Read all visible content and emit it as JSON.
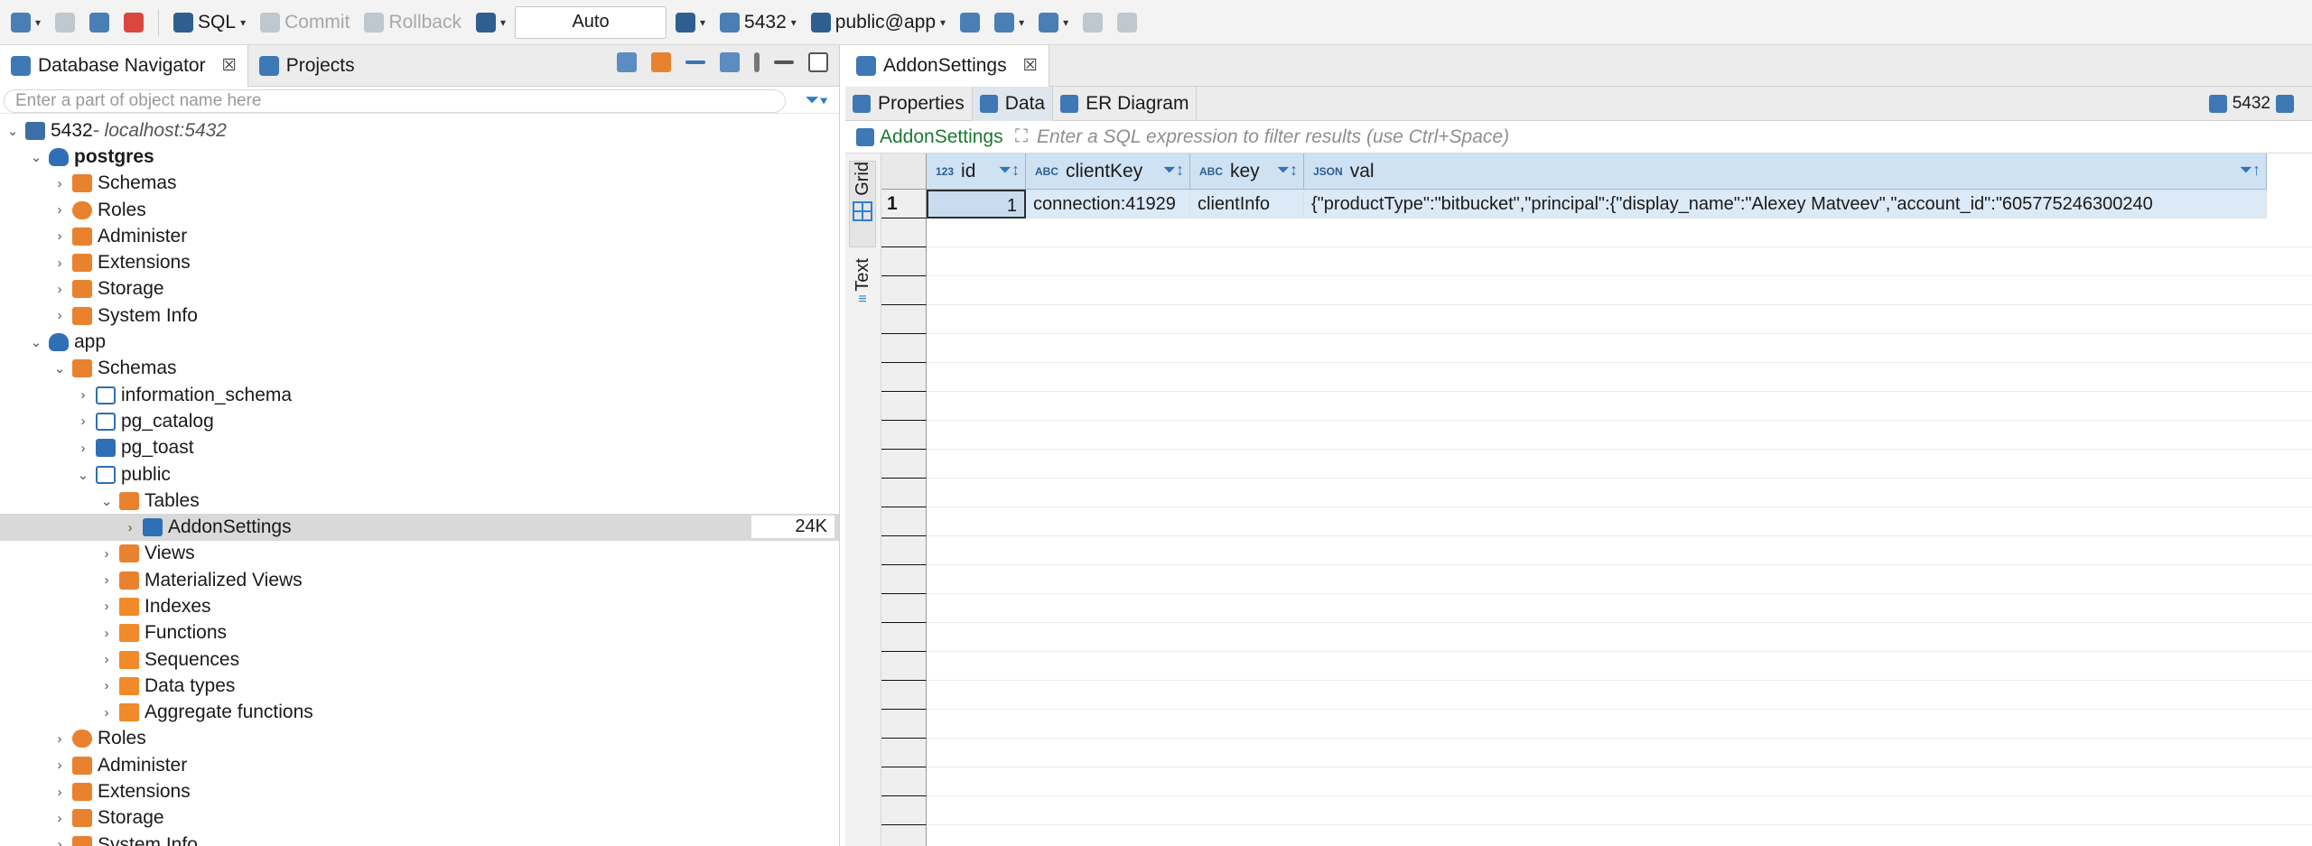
{
  "toolbar": {
    "sql_label": "SQL",
    "commit_label": "Commit",
    "rollback_label": "Rollback",
    "transaction_mode": "Auto",
    "connection": "5432",
    "schema": "public@app"
  },
  "navigator": {
    "tab_label": "Database Navigator",
    "projects_label": "Projects",
    "filter_placeholder": "Enter a part of object name here",
    "connection_name": "5432",
    "connection_host": " - localhost:5432",
    "nodes": [
      {
        "label": "postgres"
      },
      {
        "label": "Schemas"
      },
      {
        "label": "Roles"
      },
      {
        "label": "Administer"
      },
      {
        "label": "Extensions"
      },
      {
        "label": "Storage"
      },
      {
        "label": "System Info"
      },
      {
        "label": "app"
      },
      {
        "label": "Schemas"
      },
      {
        "label": "information_schema"
      },
      {
        "label": "pg_catalog"
      },
      {
        "label": "pg_toast"
      },
      {
        "label": "public"
      },
      {
        "label": "Tables"
      },
      {
        "label": "AddonSettings",
        "size": "24K"
      },
      {
        "label": "Views"
      },
      {
        "label": "Materialized Views"
      },
      {
        "label": "Indexes"
      },
      {
        "label": "Functions"
      },
      {
        "label": "Sequences"
      },
      {
        "label": "Data types"
      },
      {
        "label": "Aggregate functions"
      },
      {
        "label": "Roles"
      },
      {
        "label": "Administer"
      },
      {
        "label": "Extensions"
      },
      {
        "label": "Storage"
      },
      {
        "label": "System Info"
      }
    ]
  },
  "editor": {
    "tab_label": "AddonSettings",
    "subtabs": [
      "Properties",
      "Data",
      "ER Diagram"
    ],
    "connection_label": "5432",
    "filter_table": "AddonSettings",
    "filter_placeholder": "Enter a SQL expression to filter results (use Ctrl+Space)",
    "side_tabs": [
      "Grid",
      "Text"
    ]
  },
  "grid": {
    "columns": [
      {
        "type": "123",
        "name": "id"
      },
      {
        "type": "ABC",
        "name": "clientKey"
      },
      {
        "type": "ABC",
        "name": "key"
      },
      {
        "type": "JSON",
        "name": "val"
      }
    ],
    "rows": [
      {
        "num": "1",
        "id": "1",
        "clientKey": "connection:41929",
        "key": "clientInfo",
        "val": "{\"productType\":\"bitbucket\",\"principal\":{\"display_name\":\"Alexey Matveev\",\"account_id\":\"605775246300240"
      }
    ]
  }
}
